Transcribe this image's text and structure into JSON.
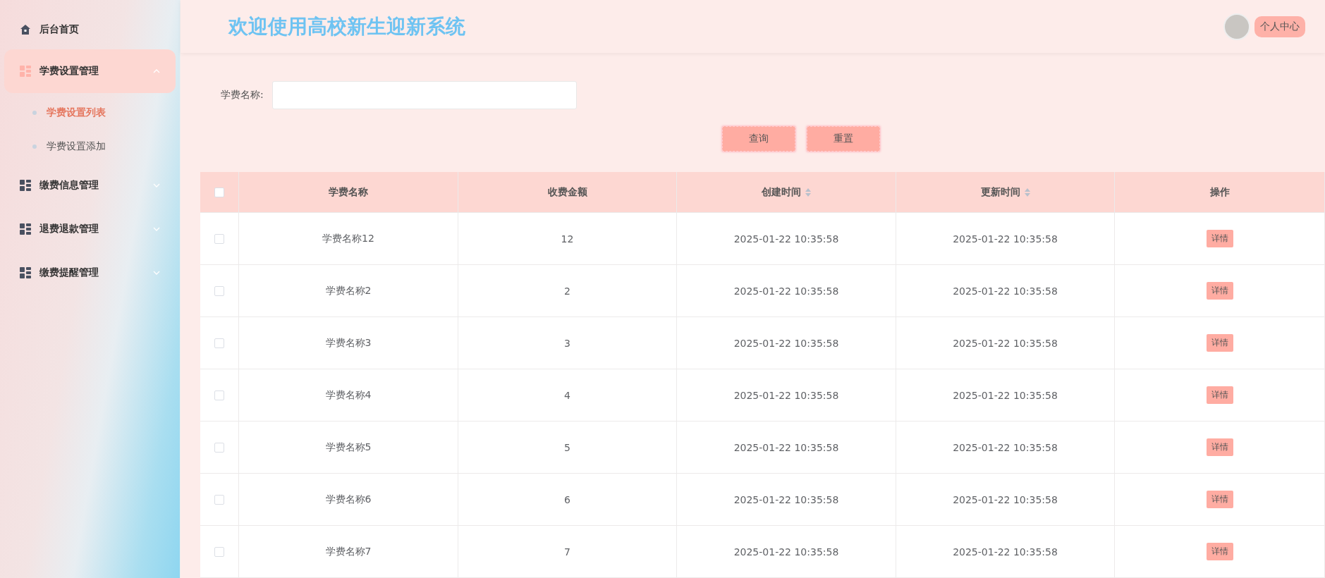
{
  "sidebar": {
    "items": [
      {
        "label": "后台首页",
        "kind": "home",
        "expanded": false
      },
      {
        "label": "学费设置管理",
        "kind": "group",
        "expanded": true,
        "children": [
          {
            "label": "学费设置列表",
            "selected": true
          },
          {
            "label": "学费设置添加",
            "selected": false
          }
        ]
      },
      {
        "label": "缴费信息管理",
        "kind": "group",
        "expanded": false
      },
      {
        "label": "退费退款管理",
        "kind": "group",
        "expanded": false
      },
      {
        "label": "缴费提醒管理",
        "kind": "group",
        "expanded": false
      }
    ]
  },
  "header": {
    "title": "欢迎使用高校新生迎新系统",
    "user_button": "个人中心"
  },
  "search": {
    "label": "学费名称:",
    "buttons": [
      "查询",
      "重置"
    ]
  },
  "table": {
    "select_all_checked": false,
    "columns": [
      {
        "label": "学费名称",
        "sortable": false
      },
      {
        "label": "收费金额",
        "sortable": false
      },
      {
        "label": "创建时间",
        "sortable": true
      },
      {
        "label": "更新时间",
        "sortable": true
      },
      {
        "label": "操作",
        "sortable": false
      }
    ],
    "rows": [
      {
        "checked": false,
        "name": "学费名称12",
        "amount": "12",
        "created": "2025-01-22 10:35:58",
        "updated": "2025-01-22 10:35:58",
        "action": "详情"
      },
      {
        "checked": false,
        "name": "学费名称2",
        "amount": "2",
        "created": "2025-01-22 10:35:58",
        "updated": "2025-01-22 10:35:58",
        "action": "详情"
      },
      {
        "checked": false,
        "name": "学费名称3",
        "amount": "3",
        "created": "2025-01-22 10:35:58",
        "updated": "2025-01-22 10:35:58",
        "action": "详情"
      },
      {
        "checked": false,
        "name": "学费名称4",
        "amount": "4",
        "created": "2025-01-22 10:35:58",
        "updated": "2025-01-22 10:35:58",
        "action": "详情"
      },
      {
        "checked": false,
        "name": "学费名称5",
        "amount": "5",
        "created": "2025-01-22 10:35:58",
        "updated": "2025-01-22 10:35:58",
        "action": "详情"
      },
      {
        "checked": false,
        "name": "学费名称6",
        "amount": "6",
        "created": "2025-01-22 10:35:58",
        "updated": "2025-01-22 10:35:58",
        "action": "详情"
      },
      {
        "checked": false,
        "name": "学费名称7",
        "amount": "7",
        "created": "2025-01-22 10:35:58",
        "updated": "2025-01-22 10:35:58",
        "action": "详情"
      }
    ]
  }
}
